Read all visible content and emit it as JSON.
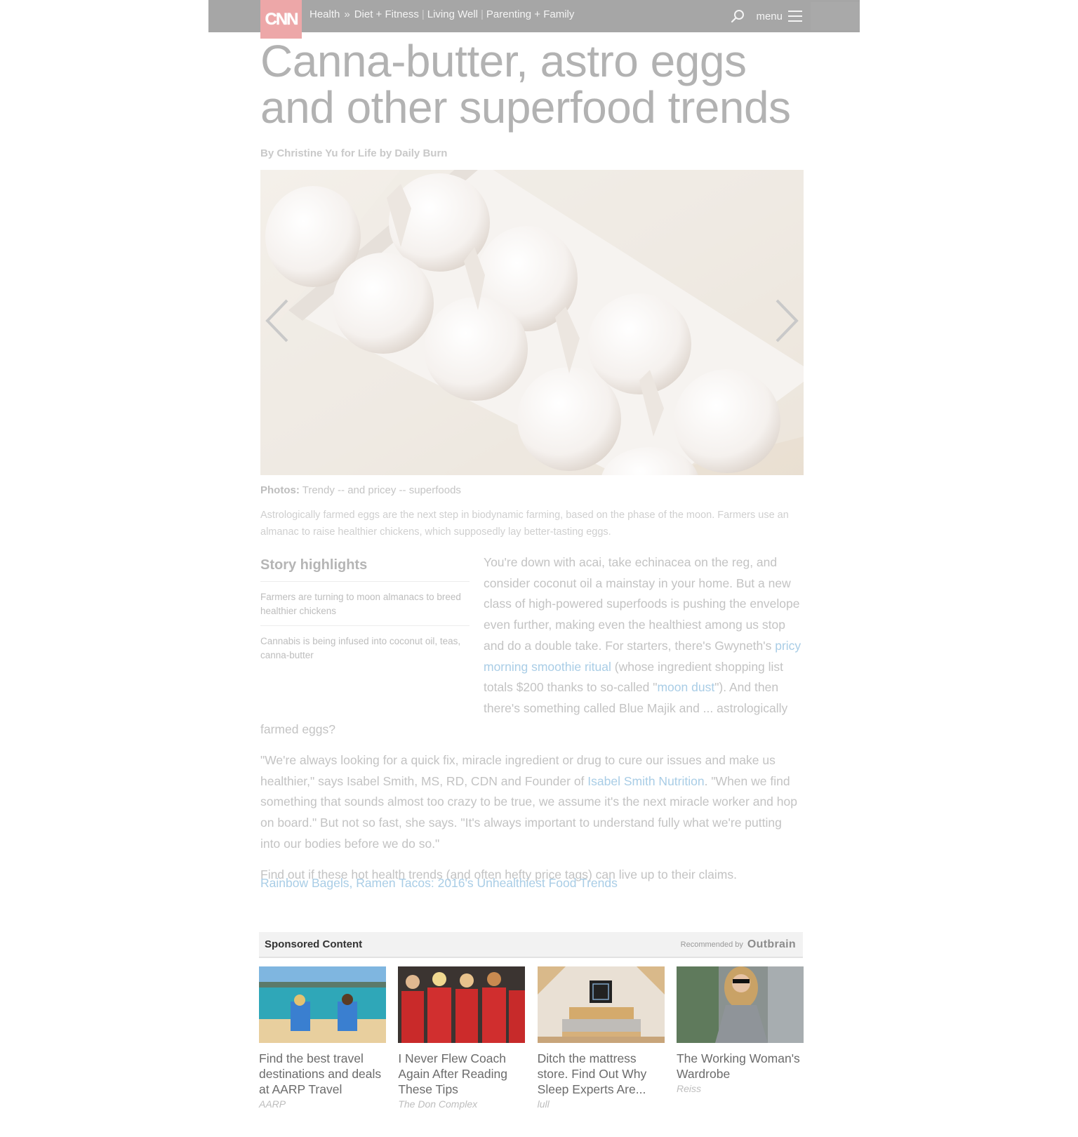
{
  "nav": {
    "logo_text": "CNN",
    "section": "Health",
    "separator": "»",
    "links": [
      "Diet + Fitness",
      "Living Well",
      "Parenting + Family"
    ],
    "menu_label": "menu"
  },
  "article": {
    "headline_line1": "Canna-butter, astro eggs",
    "headline_line2": "and other superfood trends",
    "byline": "By Christine Yu for Life by Daily Burn",
    "gallery": {
      "caption_label": "Photos:",
      "caption_title": "Trendy -- and pricey -- superfoods",
      "caption_description": "Astrologically farmed eggs are the next step in biodynamic farming, based on the phase of the moon. Farmers use an almanac to raise healthier chickens, which supposedly lay better-tasting eggs.",
      "prev_icon": "chevron-left-icon",
      "next_icon": "chevron-right-icon"
    },
    "highlights": {
      "title": "Story highlights",
      "items": [
        "Farmers are turning to moon almanacs to breed healthier chickens",
        "Cannabis is being infused into coconut oil, teas, canna-butter"
      ]
    },
    "paragraphs": {
      "p1_a": "You're down with acai, take echinacea on the reg, and consider coconut oil a mainstay in your home. But a new class of high-powered superfoods is pushing the envelope even further, making even the healthiest among us stop and do a double take. For starters, there's Gwyneth's ",
      "p1_link1": "pricy morning smoothie ritual",
      "p1_b": " (whose ingredient shopping list totals $200 thanks to so-called \"",
      "p1_link2": "moon dust",
      "p1_c": "\"). And then there's something called Blue Majik and ... astrologically farmed eggs?",
      "p2_a": "\"We're always looking for a quick fix, miracle ingredient or drug to cure our issues and make us healthier,\" says Isabel Smith, MS, RD, CDN and Founder of ",
      "p2_link": "Isabel Smith Nutrition",
      "p2_b": ". \"When we find something that sounds almost too crazy to be true, we assume it's the next miracle worker and hop on board.\" But not so fast, she says. \"It's always important to understand fully what we're putting into our bodies before we do so.\"",
      "p3": "Find out if these hot health trends (and often hefty price tags) can live up to their claims."
    },
    "related_link": "Rainbow Bagels, Ramen Tacos: 2016's Unhealthiest Food Trends"
  },
  "sponsored": {
    "title": "Sponsored Content",
    "recommended_by": "Recommended by",
    "provider": "Outbrain",
    "cards": [
      {
        "title": "Find the best travel destinations and deals at AARP Travel",
        "source": "AARP"
      },
      {
        "title": "I Never Flew Coach Again After Reading These Tips",
        "source": "The Don Complex"
      },
      {
        "title": "Ditch the mattress store. Find Out Why Sleep Experts Are...",
        "source": "lull"
      },
      {
        "title": "The Working Woman's Wardrobe",
        "source": "Reiss"
      }
    ]
  },
  "colors": {
    "nav_bg": "#a6a6a6",
    "logo_bg": "#eda7a8",
    "link": "#a9cde6",
    "headline": "#b2b2b2"
  }
}
